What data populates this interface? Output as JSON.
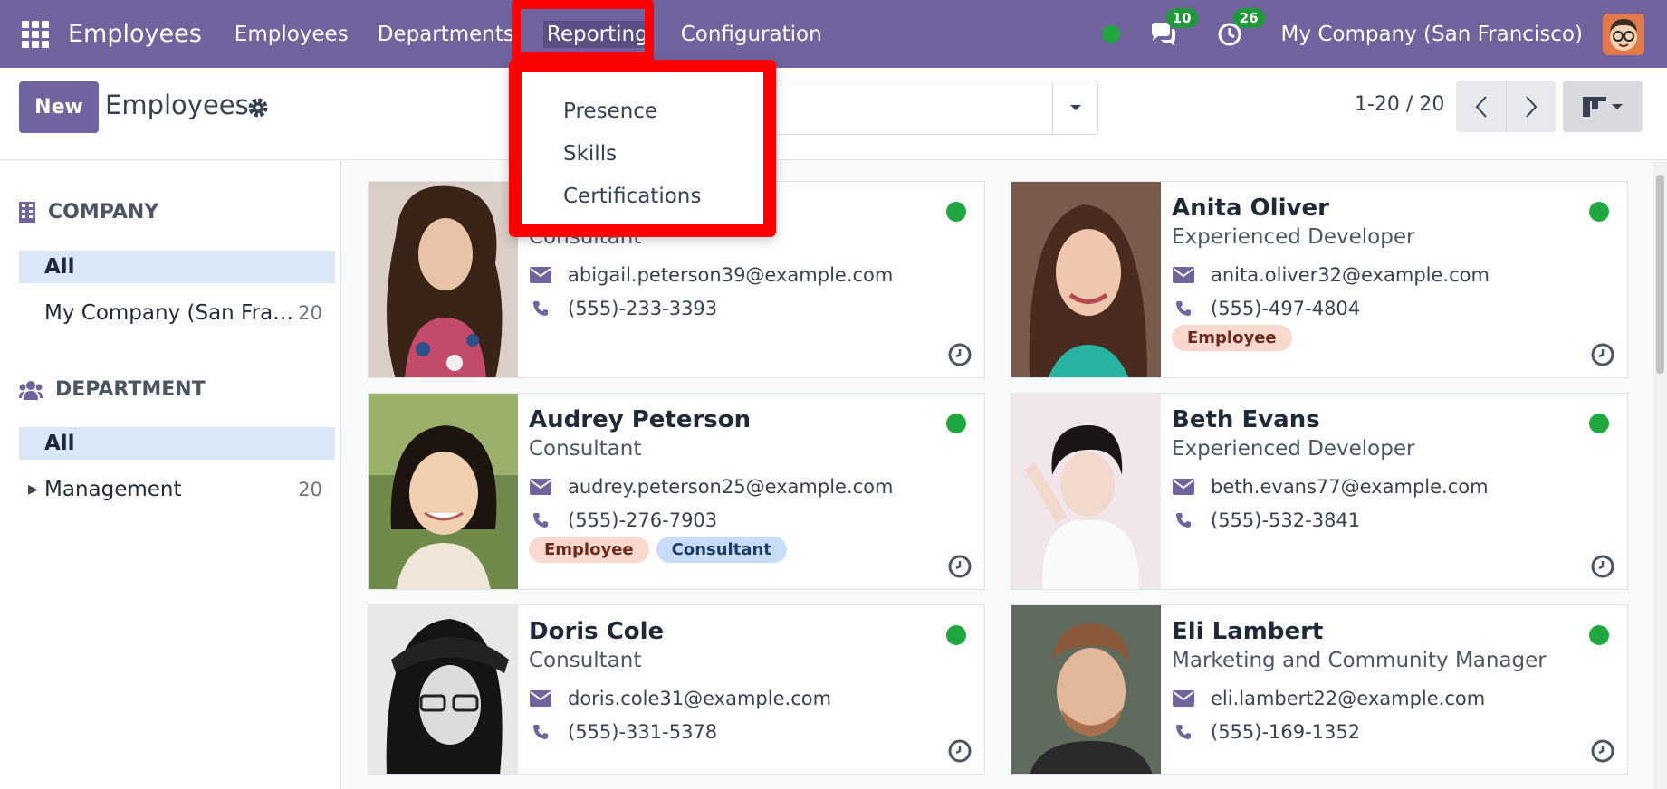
{
  "navbar": {
    "app_title": "Employees",
    "menu": [
      {
        "label": "Employees"
      },
      {
        "label": "Departments"
      },
      {
        "label": "Reporting"
      },
      {
        "label": "Configuration"
      }
    ],
    "messages_count": "10",
    "activities_count": "26",
    "company": "My Company (San Francisco)"
  },
  "dropdown": {
    "items": [
      "Presence",
      "Skills",
      "Certifications"
    ]
  },
  "control": {
    "new_label": "New",
    "title": "Employees",
    "pager": "1-20 / 20"
  },
  "sidebar": {
    "company_header": "COMPANY",
    "company_items": [
      {
        "label": "All",
        "count": ""
      },
      {
        "label": "My Company (San Fra…",
        "count": "20"
      }
    ],
    "department_header": "DEPARTMENT",
    "department_items": [
      {
        "label": "All",
        "count": ""
      },
      {
        "label": "Management",
        "count": "20"
      }
    ]
  },
  "employees": [
    {
      "name": "",
      "job": "Consultant",
      "email": "abigail.peterson39@example.com",
      "phone": "(555)-233-3393",
      "tags": []
    },
    {
      "name": "Anita Oliver",
      "job": "Experienced Developer",
      "email": "anita.oliver32@example.com",
      "phone": "(555)-497-4804",
      "tags": [
        "Employee"
      ]
    },
    {
      "name": "Audrey Peterson",
      "job": "Consultant",
      "email": "audrey.peterson25@example.com",
      "phone": "(555)-276-7903",
      "tags": [
        "Employee",
        "Consultant"
      ]
    },
    {
      "name": "Beth Evans",
      "job": "Experienced Developer",
      "email": "beth.evans77@example.com",
      "phone": "(555)-532-3841",
      "tags": []
    },
    {
      "name": "Doris Cole",
      "job": "Consultant",
      "email": "doris.cole31@example.com",
      "phone": "(555)-331-5378",
      "tags": []
    },
    {
      "name": "Eli Lambert",
      "job": "Marketing and Community Manager",
      "email": "eli.lambert22@example.com",
      "phone": "(555)-169-1352",
      "tags": []
    }
  ],
  "colors": {
    "brand": "#71639e",
    "highlight": "#ff0000",
    "presence": "#21a73f"
  }
}
